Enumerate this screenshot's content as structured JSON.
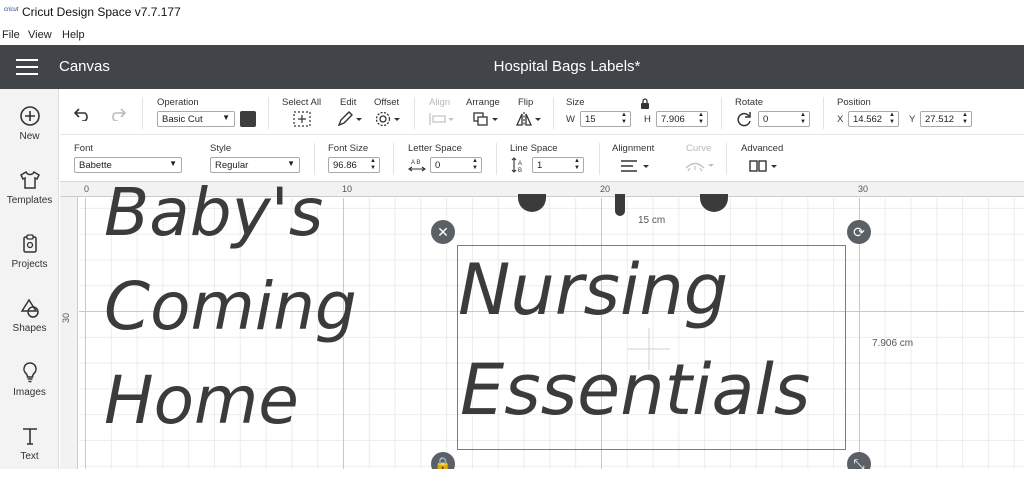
{
  "window": {
    "title": "Cricut Design Space  v7.7.177",
    "app_icon_text": "cricut"
  },
  "menu": [
    "File",
    "View",
    "Help"
  ],
  "header": {
    "canvas_label": "Canvas",
    "document_title": "Hospital Bags Labels*"
  },
  "sidebar": [
    {
      "label": "New",
      "icon": "plus-circle-icon"
    },
    {
      "label": "Templates",
      "icon": "shirt-icon"
    },
    {
      "label": "Projects",
      "icon": "projects-icon"
    },
    {
      "label": "Shapes",
      "icon": "shapes-icon"
    },
    {
      "label": "Images",
      "icon": "lightbulb-icon"
    },
    {
      "label": "Text",
      "icon": "text-icon"
    }
  ],
  "toolbar1": {
    "operation_label": "Operation",
    "operation_value": "Basic Cut",
    "operation_color": "#3d3d3d",
    "select_all_label": "Select All",
    "edit_label": "Edit",
    "offset_label": "Offset",
    "align_label": "Align",
    "arrange_label": "Arrange",
    "flip_label": "Flip",
    "size_label": "Size",
    "w_label": "W",
    "w_value": "15",
    "h_label": "H",
    "h_value": "7.906",
    "rotate_label": "Rotate",
    "rotate_value": "0",
    "position_label": "Position",
    "x_label": "X",
    "x_value": "14.562",
    "y_label": "Y",
    "y_value": "27.512"
  },
  "toolbar2": {
    "font_label": "Font",
    "font_value": "Babette",
    "style_label": "Style",
    "style_value": "Regular",
    "font_size_label": "Font Size",
    "font_size_value": "96.86",
    "letter_space_label": "Letter Space",
    "letter_space_value": "0",
    "line_space_label": "Line Space",
    "line_space_value": "1",
    "alignment_label": "Alignment",
    "curve_label": "Curve",
    "advanced_label": "Advanced"
  },
  "canvas": {
    "ruler_h": [
      "0",
      "10",
      "20",
      "30"
    ],
    "ruler_v": [
      "30"
    ],
    "left_text_lines": [
      "Baby's",
      "Coming",
      "Home"
    ],
    "selected_text_lines": [
      "Nursing",
      "Essentials"
    ],
    "width_dim": "15 cm",
    "height_dim": "7.906 cm",
    "text_color": "#3b3b3b"
  }
}
